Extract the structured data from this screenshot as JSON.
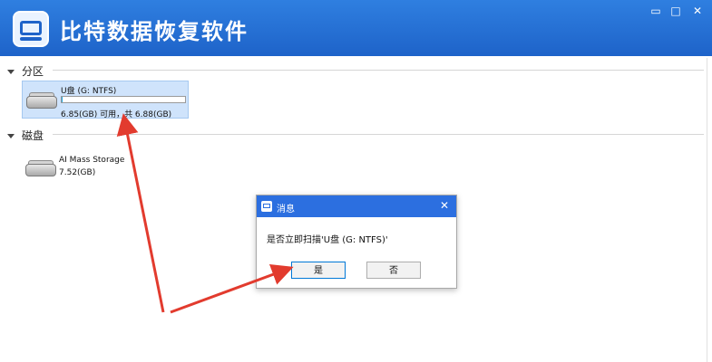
{
  "app": {
    "title": "比特数据恢复软件",
    "controls": {
      "minimize": "▭",
      "maximize": "□",
      "close": "✕"
    }
  },
  "sections": {
    "partition": {
      "label": "分区"
    },
    "disk": {
      "label": "磁盘"
    }
  },
  "partitions": [
    {
      "name": "U盘 (G: NTFS)",
      "usage": "6.85(GB) 可用，共 6.88(GB)",
      "used_fraction": 0.004
    }
  ],
  "disks": [
    {
      "name": "AI Mass Storage",
      "size": "7.52(GB)"
    }
  ],
  "dialog": {
    "title": "消息",
    "close": "✕",
    "message": "是否立即扫描'U盘 (G: NTFS)'",
    "yes_label": "是",
    "no_label": "否"
  },
  "colors": {
    "titlebar": "#1e63c9",
    "dialog_titlebar": "#2c6fe0",
    "selection": "#cfe3fb",
    "annotation_arrow": "#e23b2e"
  },
  "icons": {
    "app": "app-logo-icon",
    "drive": "drive-icon",
    "dialog": "dialog-app-icon"
  }
}
